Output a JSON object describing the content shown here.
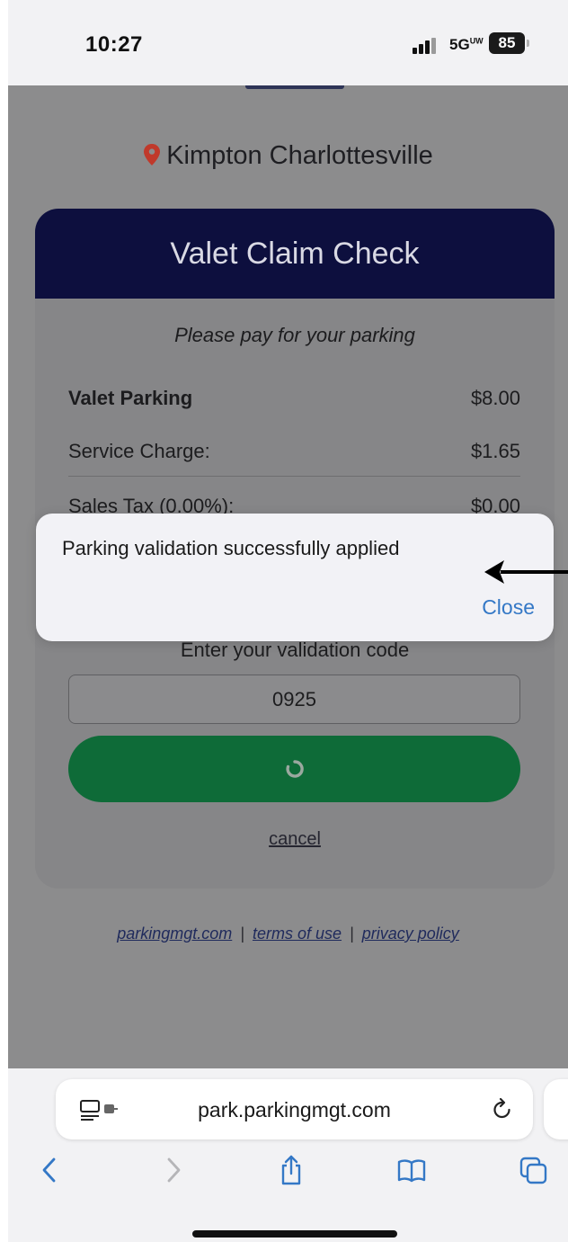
{
  "status_bar": {
    "time": "10:27",
    "network": "5G",
    "network_suffix": "UW",
    "battery": "85"
  },
  "page": {
    "location": "Kimpton Charlottesville",
    "card_title": "Valet Claim Check",
    "subtitle": "Please pay for your parking",
    "line_items": [
      {
        "label": "Valet Parking",
        "amount": "$8.00"
      },
      {
        "label": "Service Charge:",
        "amount": "$1.65"
      },
      {
        "label": "Sales Tax (0.00%):",
        "amount": "$0.00"
      }
    ],
    "validation_label": "Enter your validation code",
    "validation_code": "0925",
    "cancel_label": "cancel",
    "footer": {
      "link1": "parkingmgt.com",
      "link2": "terms of use",
      "link3": "privacy policy",
      "separator": "|"
    }
  },
  "alert": {
    "message": "Parking validation successfully applied",
    "close_label": "Close"
  },
  "browser": {
    "url": "park.parkingmgt.com"
  },
  "colors": {
    "card_header": "#0d0f3e",
    "pay_button": "#0e6b38",
    "location_pin": "#c0392b",
    "link_blue": "#3478c6"
  }
}
